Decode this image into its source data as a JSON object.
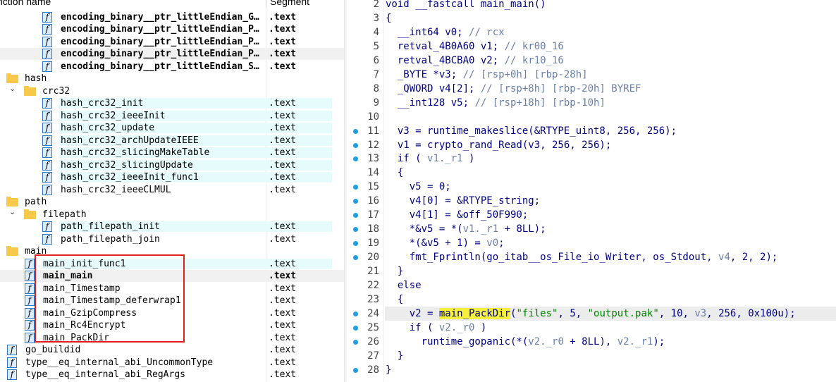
{
  "functions_window": {
    "header": {
      "name_col": "nction name",
      "segment_col": "Segment"
    },
    "rows": [
      {
        "kind": "func",
        "name": "encoding_binary__ptr_littleEndian_G…",
        "seg": ".text",
        "bold": true,
        "indent": 2
      },
      {
        "kind": "func",
        "name": "encoding_binary__ptr_littleEndian_P…",
        "seg": ".text",
        "bold": true,
        "indent": 2
      },
      {
        "kind": "func",
        "name": "encoding_binary__ptr_littleEndian_P…",
        "seg": ".text",
        "bold": true,
        "indent": 2
      },
      {
        "kind": "func",
        "name": "encoding_binary__ptr_littleEndian_P…",
        "seg": ".text",
        "bold": true,
        "indent": 2,
        "selected": true
      },
      {
        "kind": "func",
        "name": "encoding_binary__ptr_littleEndian_S…",
        "seg": ".text",
        "bold": true,
        "indent": 2
      },
      {
        "kind": "folder",
        "name": "hash",
        "indent": 0
      },
      {
        "kind": "folder",
        "name": "crc32",
        "indent": 1,
        "expanded": true
      },
      {
        "kind": "func",
        "name": "hash_crc32_init",
        "seg": ".text",
        "indent": 2,
        "hl": true
      },
      {
        "kind": "func",
        "name": "hash_crc32_ieeeInit",
        "seg": ".text",
        "indent": 2,
        "hl": true
      },
      {
        "kind": "func",
        "name": "hash_crc32_update",
        "seg": ".text",
        "indent": 2,
        "hl": true
      },
      {
        "kind": "func",
        "name": "hash_crc32_archUpdateIEEE",
        "seg": ".text",
        "indent": 2,
        "hl": true
      },
      {
        "kind": "func",
        "name": "hash_crc32_slicingMakeTable",
        "seg": ".text",
        "indent": 2,
        "hl": true
      },
      {
        "kind": "func",
        "name": "hash_crc32_slicingUpdate",
        "seg": ".text",
        "indent": 2,
        "hl": true
      },
      {
        "kind": "func",
        "name": "hash_crc32_ieeeInit_func1",
        "seg": ".text",
        "indent": 2,
        "hl": true
      },
      {
        "kind": "func",
        "name": "hash_crc32_ieeeCLMUL",
        "seg": ".text",
        "indent": 2
      },
      {
        "kind": "folder",
        "name": "path",
        "indent": 0
      },
      {
        "kind": "folder",
        "name": "filepath",
        "indent": 1,
        "expanded": true
      },
      {
        "kind": "func",
        "name": "path_filepath_init",
        "seg": ".text",
        "indent": 2,
        "hl": true
      },
      {
        "kind": "func",
        "name": "path_filepath_join",
        "seg": ".text",
        "indent": 2
      },
      {
        "kind": "folder",
        "name": "main",
        "indent": 0
      },
      {
        "kind": "func",
        "name": "main_init_func1",
        "seg": ".text",
        "indent": 1,
        "hl": true
      },
      {
        "kind": "func",
        "name": "main_main",
        "seg": ".text",
        "bold": true,
        "indent": 1,
        "selected": true
      },
      {
        "kind": "func",
        "name": "main_Timestamp",
        "seg": ".text",
        "indent": 1
      },
      {
        "kind": "func",
        "name": "main_Timestamp_deferwrap1",
        "seg": ".text",
        "indent": 1
      },
      {
        "kind": "func",
        "name": "main_GzipCompress",
        "seg": ".text",
        "indent": 1
      },
      {
        "kind": "func",
        "name": "main_Rc4Encrypt",
        "seg": ".text",
        "indent": 1
      },
      {
        "kind": "func",
        "name": "main_PackDir",
        "seg": ".text",
        "indent": 1
      },
      {
        "kind": "func",
        "name": "go_buildid",
        "seg": ".text",
        "indent": 0
      },
      {
        "kind": "func",
        "name": "type__eq_internal_abi_UncommonType",
        "seg": ".text",
        "indent": 0
      },
      {
        "kind": "func",
        "name": "type__eq_internal_abi_RegArgs",
        "seg": ".text",
        "indent": 0
      }
    ]
  },
  "pseudocode": {
    "lines": [
      {
        "n": "2",
        "dot": false,
        "parts": [
          [
            "void __fastcall main_main()",
            "k"
          ]
        ]
      },
      {
        "n": "3",
        "dot": false,
        "parts": [
          [
            "{",
            "k"
          ]
        ]
      },
      {
        "n": "4",
        "dot": false,
        "parts": [
          [
            "  __int64 v0; ",
            "k"
          ],
          [
            "// rcx",
            "c"
          ]
        ]
      },
      {
        "n": "5",
        "dot": false,
        "parts": [
          [
            "  retval_4B0A60 v1; ",
            "k"
          ],
          [
            "// kr00_16",
            "c"
          ]
        ]
      },
      {
        "n": "6",
        "dot": false,
        "parts": [
          [
            "  retval_4BCBA0 v2; ",
            "k"
          ],
          [
            "// kr10_16",
            "c"
          ]
        ]
      },
      {
        "n": "7",
        "dot": false,
        "parts": [
          [
            "  _BYTE *v3; ",
            "k"
          ],
          [
            "// [rsp+0h] [rbp-28h]",
            "c"
          ]
        ]
      },
      {
        "n": "8",
        "dot": false,
        "parts": [
          [
            "  _QWORD v4[2]; ",
            "k"
          ],
          [
            "// [rsp+8h] [rbp-20h] BYREF",
            "c"
          ]
        ]
      },
      {
        "n": "9",
        "dot": false,
        "parts": [
          [
            "  __int128 v5; ",
            "k"
          ],
          [
            "// [rsp+18h] [rbp-10h]",
            "c"
          ]
        ]
      },
      {
        "n": "10",
        "dot": false,
        "parts": [
          [
            "",
            "k"
          ]
        ]
      },
      {
        "n": "11",
        "dot": true,
        "parts": [
          [
            "  v3 = runtime_makeslice(&RTYPE_uint8, 256, 256);",
            "k"
          ]
        ]
      },
      {
        "n": "12",
        "dot": true,
        "parts": [
          [
            "  v1 = crypto_rand_Read(v3, 256, 256);",
            "k"
          ]
        ]
      },
      {
        "n": "13",
        "dot": true,
        "parts": [
          [
            "  if ( ",
            "k"
          ],
          [
            "v1._r1",
            "v"
          ],
          [
            " )",
            "k"
          ]
        ]
      },
      {
        "n": "14",
        "dot": false,
        "parts": [
          [
            "  {",
            "k"
          ]
        ]
      },
      {
        "n": "15",
        "dot": true,
        "parts": [
          [
            "    v5 = 0;",
            "k"
          ]
        ]
      },
      {
        "n": "16",
        "dot": true,
        "parts": [
          [
            "    v4[0] = &RTYPE_string;",
            "k"
          ]
        ]
      },
      {
        "n": "17",
        "dot": true,
        "parts": [
          [
            "    v4[1] = &off_50F990;",
            "k"
          ]
        ]
      },
      {
        "n": "18",
        "dot": true,
        "parts": [
          [
            "    *&v5 = *(",
            "k"
          ],
          [
            "v1._r1",
            "v"
          ],
          [
            " + 8LL);",
            "k"
          ]
        ]
      },
      {
        "n": "19",
        "dot": true,
        "parts": [
          [
            "    *(&v5 + 1) = ",
            "k"
          ],
          [
            "v0",
            "v"
          ],
          [
            ";",
            "k"
          ]
        ]
      },
      {
        "n": "20",
        "dot": true,
        "parts": [
          [
            "    fmt_Fprintln(go_itab__os_File_io_Writer, os_Stdout, ",
            "k"
          ],
          [
            "v4",
            "v"
          ],
          [
            ", 2, 2);",
            "k"
          ]
        ]
      },
      {
        "n": "21",
        "dot": false,
        "parts": [
          [
            "  }",
            "k"
          ]
        ]
      },
      {
        "n": "22",
        "dot": false,
        "parts": [
          [
            "  else",
            "k"
          ]
        ]
      },
      {
        "n": "23",
        "dot": false,
        "parts": [
          [
            "  {",
            "k"
          ]
        ]
      },
      {
        "n": "24",
        "dot": true,
        "cur": true,
        "parts": [
          [
            "    v2 = ",
            "k"
          ],
          [
            "main_PackDir",
            "h"
          ],
          [
            "(",
            "k"
          ],
          [
            "\"files\"",
            "s"
          ],
          [
            ", 5, ",
            "k"
          ],
          [
            "\"output.pak\"",
            "s"
          ],
          [
            ", 10, ",
            "k"
          ],
          [
            "v3",
            "v"
          ],
          [
            ", 256, 0x100u);",
            "k"
          ]
        ]
      },
      {
        "n": "25",
        "dot": true,
        "parts": [
          [
            "    if ( ",
            "k"
          ],
          [
            "v2._r0",
            "v"
          ],
          [
            " )",
            "k"
          ]
        ]
      },
      {
        "n": "26",
        "dot": true,
        "parts": [
          [
            "      runtime_gopanic(*(",
            "k"
          ],
          [
            "v2._r0",
            "v"
          ],
          [
            " + 8LL), ",
            "k"
          ],
          [
            "v2._r1",
            "v"
          ],
          [
            ");",
            "k"
          ]
        ]
      },
      {
        "n": "27",
        "dot": false,
        "parts": [
          [
            "  }",
            "k"
          ]
        ]
      },
      {
        "n": "28",
        "dot": true,
        "parts": [
          [
            "}",
            "k"
          ]
        ]
      }
    ]
  },
  "icons": {
    "function": "f-icon",
    "folder": "folder-icon",
    "expand": "chevron-down-icon",
    "breakpoint": "breakpoint-dot"
  },
  "colors": {
    "keyword": "#000080",
    "variable": "#6a7ea8",
    "string": "#008000",
    "highlight": "#f5f03c",
    "dot": "#1aa0e6",
    "box": "#e0201c"
  }
}
